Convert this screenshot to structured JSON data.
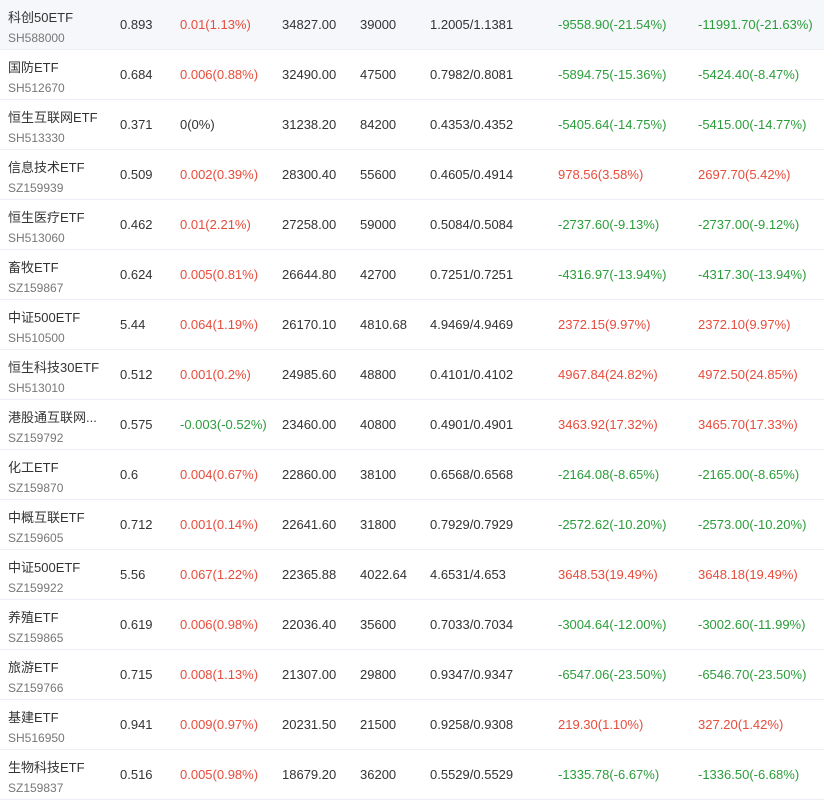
{
  "colors": {
    "up": "#e74c3c",
    "down": "#2a9d3a",
    "flat": "#333333",
    "text": "#333333",
    "subtext": "#777777",
    "divider": "#ebeef5"
  },
  "rows": [
    {
      "name": "科创50ETF",
      "code": "SH588000",
      "price": "0.893",
      "change": "0.01(1.13%)",
      "change_dir": "up",
      "value": "34827.00",
      "shares": "39000",
      "cost": "1.2005/1.1381",
      "pnl1": "-9558.90(-21.54%)",
      "pnl1_dir": "down",
      "pnl2": "-11991.70(-21.63%)",
      "pnl2_dir": "down"
    },
    {
      "name": "国防ETF",
      "code": "SH512670",
      "price": "0.684",
      "change": "0.006(0.88%)",
      "change_dir": "up",
      "value": "32490.00",
      "shares": "47500",
      "cost": "0.7982/0.8081",
      "pnl1": "-5894.75(-15.36%)",
      "pnl1_dir": "down",
      "pnl2": "-5424.40(-8.47%)",
      "pnl2_dir": "down"
    },
    {
      "name": "恒生互联网ETF",
      "code": "SH513330",
      "price": "0.371",
      "change": "0(0%)",
      "change_dir": "flat",
      "value": "31238.20",
      "shares": "84200",
      "cost": "0.4353/0.4352",
      "pnl1": "-5405.64(-14.75%)",
      "pnl1_dir": "down",
      "pnl2": "-5415.00(-14.77%)",
      "pnl2_dir": "down"
    },
    {
      "name": "信息技术ETF",
      "code": "SZ159939",
      "price": "0.509",
      "change": "0.002(0.39%)",
      "change_dir": "up",
      "value": "28300.40",
      "shares": "55600",
      "cost": "0.4605/0.4914",
      "pnl1": "978.56(3.58%)",
      "pnl1_dir": "up",
      "pnl2": "2697.70(5.42%)",
      "pnl2_dir": "up"
    },
    {
      "name": "恒生医疗ETF",
      "code": "SH513060",
      "price": "0.462",
      "change": "0.01(2.21%)",
      "change_dir": "up",
      "value": "27258.00",
      "shares": "59000",
      "cost": "0.5084/0.5084",
      "pnl1": "-2737.60(-9.13%)",
      "pnl1_dir": "down",
      "pnl2": "-2737.00(-9.12%)",
      "pnl2_dir": "down"
    },
    {
      "name": "畜牧ETF",
      "code": "SZ159867",
      "price": "0.624",
      "change": "0.005(0.81%)",
      "change_dir": "up",
      "value": "26644.80",
      "shares": "42700",
      "cost": "0.7251/0.7251",
      "pnl1": "-4316.97(-13.94%)",
      "pnl1_dir": "down",
      "pnl2": "-4317.30(-13.94%)",
      "pnl2_dir": "down"
    },
    {
      "name": "中证500ETF",
      "code": "SH510500",
      "price": "5.44",
      "change": "0.064(1.19%)",
      "change_dir": "up",
      "value": "26170.10",
      "shares": "4810.68",
      "cost": "4.9469/4.9469",
      "pnl1": "2372.15(9.97%)",
      "pnl1_dir": "up",
      "pnl2": "2372.10(9.97%)",
      "pnl2_dir": "up"
    },
    {
      "name": "恒生科技30ETF",
      "code": "SH513010",
      "price": "0.512",
      "change": "0.001(0.2%)",
      "change_dir": "up",
      "value": "24985.60",
      "shares": "48800",
      "cost": "0.4101/0.4102",
      "pnl1": "4967.84(24.82%)",
      "pnl1_dir": "up",
      "pnl2": "4972.50(24.85%)",
      "pnl2_dir": "up"
    },
    {
      "name": "港股通互联网...",
      "code": "SZ159792",
      "price": "0.575",
      "change": "-0.003(-0.52%)",
      "change_dir": "down",
      "value": "23460.00",
      "shares": "40800",
      "cost": "0.4901/0.4901",
      "pnl1": "3463.92(17.32%)",
      "pnl1_dir": "up",
      "pnl2": "3465.70(17.33%)",
      "pnl2_dir": "up"
    },
    {
      "name": "化工ETF",
      "code": "SZ159870",
      "price": "0.6",
      "change": "0.004(0.67%)",
      "change_dir": "up",
      "value": "22860.00",
      "shares": "38100",
      "cost": "0.6568/0.6568",
      "pnl1": "-2164.08(-8.65%)",
      "pnl1_dir": "down",
      "pnl2": "-2165.00(-8.65%)",
      "pnl2_dir": "down"
    },
    {
      "name": "中概互联ETF",
      "code": "SZ159605",
      "price": "0.712",
      "change": "0.001(0.14%)",
      "change_dir": "up",
      "value": "22641.60",
      "shares": "31800",
      "cost": "0.7929/0.7929",
      "pnl1": "-2572.62(-10.20%)",
      "pnl1_dir": "down",
      "pnl2": "-2573.00(-10.20%)",
      "pnl2_dir": "down"
    },
    {
      "name": "中证500ETF",
      "code": "SZ159922",
      "price": "5.56",
      "change": "0.067(1.22%)",
      "change_dir": "up",
      "value": "22365.88",
      "shares": "4022.64",
      "cost": "4.6531/4.653",
      "pnl1": "3648.53(19.49%)",
      "pnl1_dir": "up",
      "pnl2": "3648.18(19.49%)",
      "pnl2_dir": "up"
    },
    {
      "name": "养殖ETF",
      "code": "SZ159865",
      "price": "0.619",
      "change": "0.006(0.98%)",
      "change_dir": "up",
      "value": "22036.40",
      "shares": "35600",
      "cost": "0.7033/0.7034",
      "pnl1": "-3004.64(-12.00%)",
      "pnl1_dir": "down",
      "pnl2": "-3002.60(-11.99%)",
      "pnl2_dir": "down"
    },
    {
      "name": "旅游ETF",
      "code": "SZ159766",
      "price": "0.715",
      "change": "0.008(1.13%)",
      "change_dir": "up",
      "value": "21307.00",
      "shares": "29800",
      "cost": "0.9347/0.9347",
      "pnl1": "-6547.06(-23.50%)",
      "pnl1_dir": "down",
      "pnl2": "-6546.70(-23.50%)",
      "pnl2_dir": "down"
    },
    {
      "name": "基建ETF",
      "code": "SH516950",
      "price": "0.941",
      "change": "0.009(0.97%)",
      "change_dir": "up",
      "value": "20231.50",
      "shares": "21500",
      "cost": "0.9258/0.9308",
      "pnl1": "219.30(1.10%)",
      "pnl1_dir": "up",
      "pnl2": "327.20(1.42%)",
      "pnl2_dir": "up"
    },
    {
      "name": "生物科技ETF",
      "code": "SZ159837",
      "price": "0.516",
      "change": "0.005(0.98%)",
      "change_dir": "up",
      "value": "18679.20",
      "shares": "36200",
      "cost": "0.5529/0.5529",
      "pnl1": "-1335.78(-6.67%)",
      "pnl1_dir": "down",
      "pnl2": "-1336.50(-6.68%)",
      "pnl2_dir": "down"
    }
  ]
}
